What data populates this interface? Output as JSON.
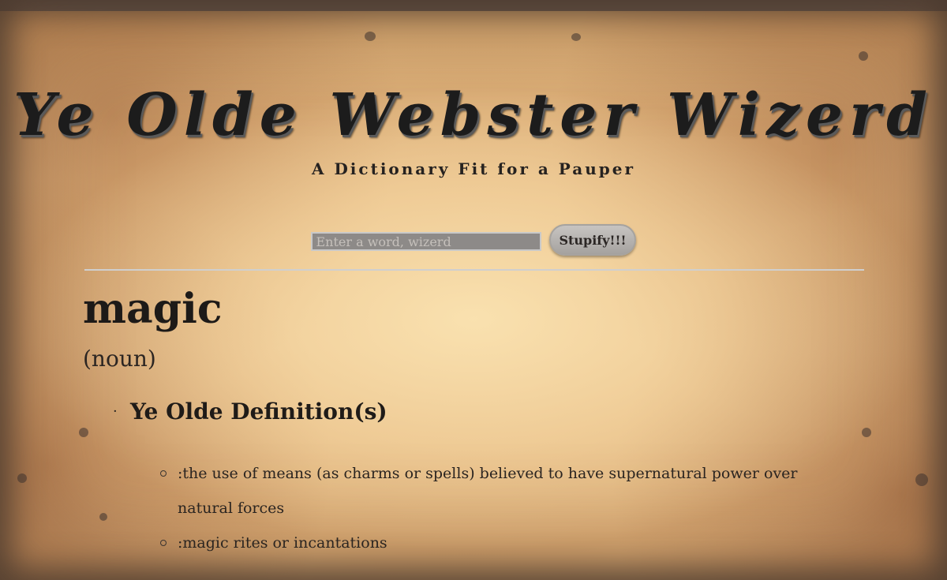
{
  "header": {
    "title": "Ye Olde Webster Wizerd",
    "subtitle": "A Dictionary Fit for a Pauper"
  },
  "search": {
    "placeholder": "Enter a word, wizerd",
    "value": "",
    "button_label": "Stupify!!!"
  },
  "entry": {
    "word": "magic",
    "part_of_speech": "(noun)",
    "definitions_heading": "Ye Olde Definition(s)",
    "definitions": [
      ":the use of means (as charms or spells) believed to have supernatural power over natural forces",
      ":magic rites or incantations"
    ]
  },
  "colors": {
    "parchment": "#ecc894",
    "burnt_edge": "#5a5452",
    "ink": "#1c1c1c",
    "input_bg": "#8d8a88",
    "button_bg": "#b8b5b2",
    "divider": "#cfcfcf"
  }
}
